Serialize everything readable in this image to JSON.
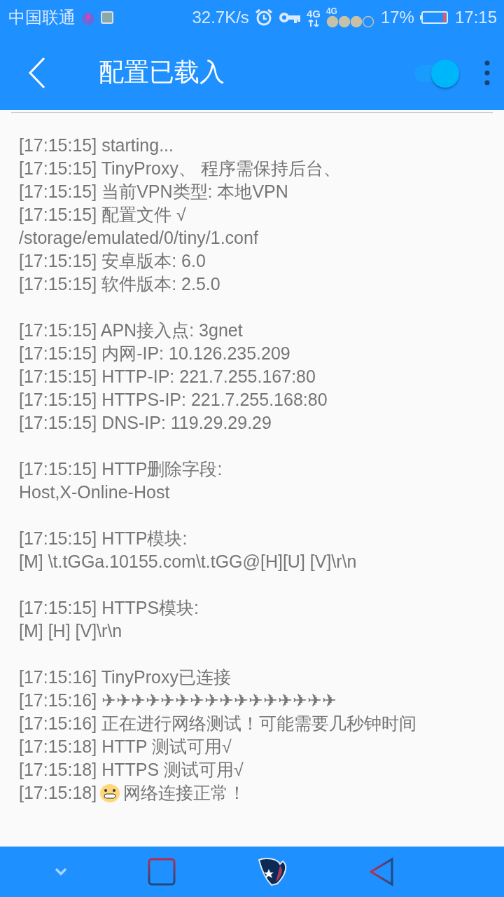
{
  "status_bar": {
    "carrier": "中国联通",
    "speed": "32.7K/s",
    "network": "4G",
    "network_small": "4G",
    "battery": "17%",
    "time": "17:15"
  },
  "header": {
    "title": "配置已载入",
    "vpn_toggle": {
      "on": true
    }
  },
  "log": [
    {
      "lines": [
        {
          "kind": "text",
          "text": "[17:15:15] starting..."
        },
        {
          "kind": "text",
          "text": "[17:15:15] TinyProxy、 程序需保持后台、"
        },
        {
          "kind": "text",
          "text": "[17:15:15] 当前VPN类型: 本地VPN"
        },
        {
          "kind": "text",
          "text": "[17:15:15] 配置文件 √"
        },
        {
          "kind": "text",
          "text": "/storage/emulated/0/tiny/1.conf"
        },
        {
          "kind": "text",
          "text": "[17:15:15] 安卓版本: 6.0"
        },
        {
          "kind": "text",
          "text": "[17:15:15] 软件版本: 2.5.0"
        }
      ]
    },
    {
      "lines": [
        {
          "kind": "text",
          "text": "[17:15:15] APN接入点: 3gnet"
        },
        {
          "kind": "text",
          "text": "[17:15:15] 内网-IP: 10.126.235.209"
        },
        {
          "kind": "text",
          "text": "[17:15:15] HTTP-IP: 221.7.255.167:80"
        },
        {
          "kind": "text",
          "text": "[17:15:15] HTTPS-IP: 221.7.255.168:80"
        },
        {
          "kind": "text",
          "text": "[17:15:15] DNS-IP: 119.29.29.29"
        }
      ]
    },
    {
      "lines": [
        {
          "kind": "text",
          "text": "[17:15:15] HTTP删除字段:"
        },
        {
          "kind": "text",
          "text": "Host,X-Online-Host"
        }
      ]
    },
    {
      "lines": [
        {
          "kind": "text",
          "text": "[17:15:15] HTTP模块:"
        },
        {
          "kind": "text",
          "text": "[M] \\t.tGGa.10155.com\\t.tGG@[H][U] [V]\\r\\n"
        }
      ]
    },
    {
      "lines": [
        {
          "kind": "text",
          "text": "[17:15:15] HTTPS模块:"
        },
        {
          "kind": "text",
          "text": "[M] [H] [V]\\r\\n"
        }
      ]
    },
    {
      "lines": [
        {
          "kind": "text",
          "text": "[17:15:16] TinyProxy已连接"
        },
        {
          "kind": "text",
          "text": "[17:15:16] ✈✈✈✈✈✈✈✈✈✈✈✈✈✈✈✈"
        },
        {
          "kind": "text",
          "text": "[17:15:16] 正在进行网络测试！可能需要几秒钟时间"
        },
        {
          "kind": "text",
          "text": "[17:15:18] HTTP 测试可用√"
        },
        {
          "kind": "text",
          "text": "[17:15:18] HTTPS 测试可用√"
        },
        {
          "kind": "emoji",
          "stamp": "[17:15:18]",
          "text": "网络连接正常！"
        }
      ]
    }
  ]
}
